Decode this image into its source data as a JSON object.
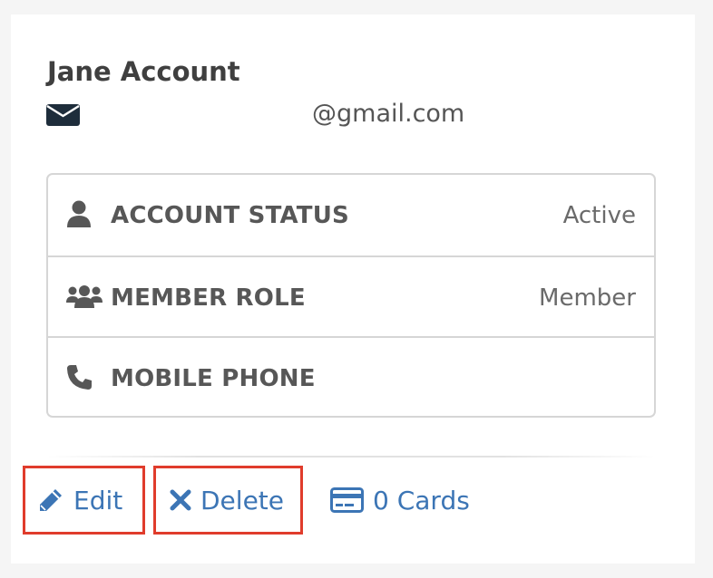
{
  "profile": {
    "name": "Jane Account",
    "email": "@gmail.com",
    "email_icon": "envelope-icon"
  },
  "details": [
    {
      "icon": "user-icon",
      "label": "ACCOUNT STATUS",
      "value": "Active"
    },
    {
      "icon": "users-icon",
      "label": "MEMBER ROLE",
      "value": "Member"
    },
    {
      "icon": "phone-icon",
      "label": "MOBILE PHONE",
      "value": ""
    }
  ],
  "actions": {
    "edit": {
      "label": "Edit",
      "icon": "pencil-icon"
    },
    "delete": {
      "label": "Delete",
      "icon": "times-icon"
    },
    "cards": {
      "label": "0 Cards",
      "icon": "credit-card-icon"
    }
  },
  "colors": {
    "link": "#3c75b5",
    "highlight_border": "#e03c2c",
    "icon_dark": "#1e2d3b",
    "text_dark": "#3f3f3f"
  }
}
